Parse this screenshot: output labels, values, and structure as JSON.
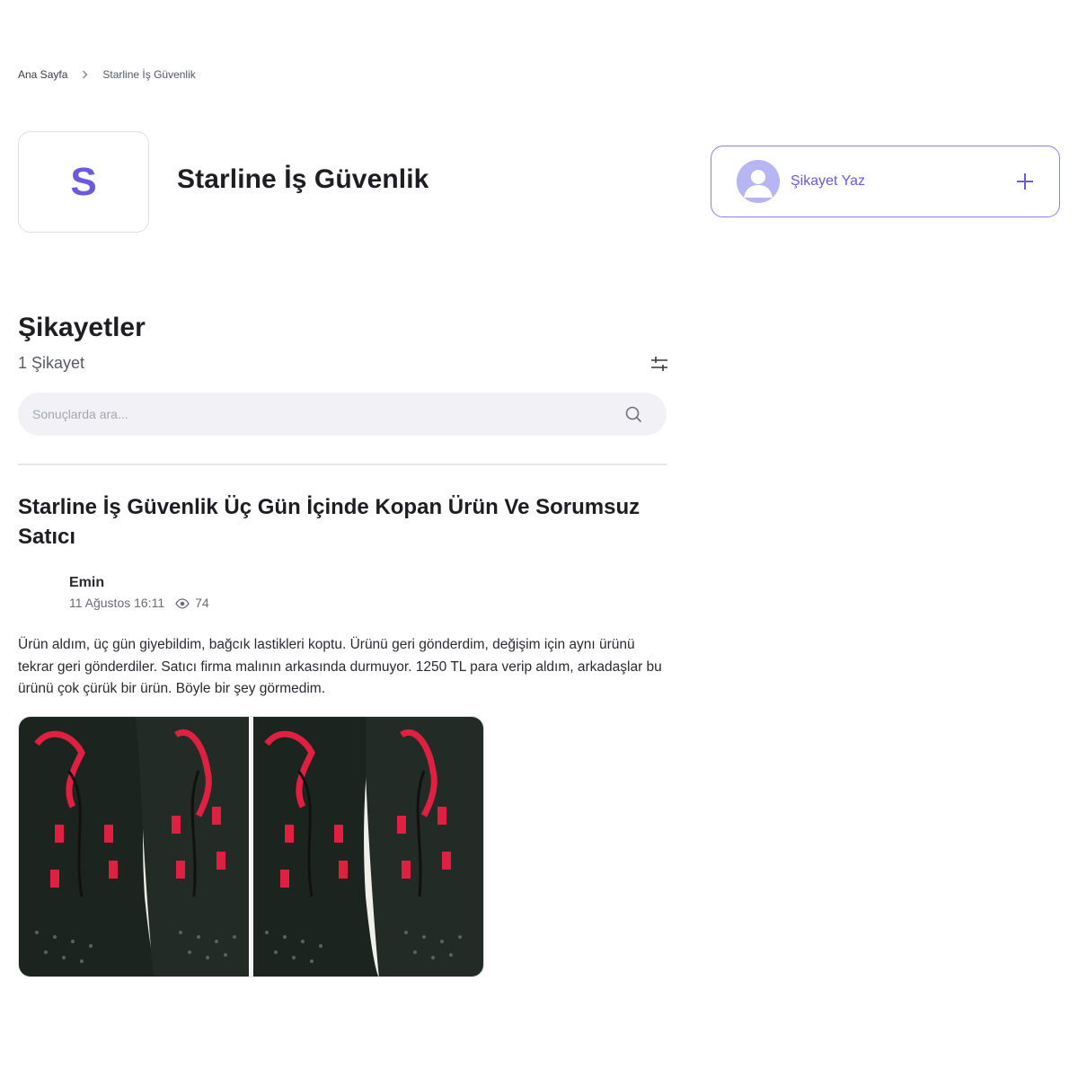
{
  "breadcrumb": {
    "home": "Ana Sayfa",
    "current": "Starline İş Güvenlik"
  },
  "brand": {
    "logo_letter": "S",
    "name": "Starline İş Güvenlik",
    "accent_color": "#6a5ae0"
  },
  "write_card": {
    "label": "Şikayet Yaz",
    "icon": "plus-icon"
  },
  "complaints": {
    "title": "Şikayetler",
    "count_text": "1 Şikayet",
    "search_placeholder": "Sonuçlarda ara...",
    "search_value": ""
  },
  "complaint": {
    "title": "Starline İş Güvenlik Üç Gün İçinde Kopan Ürün Ve Sorumsuz Satıcı",
    "author": "Emin",
    "date": "11 Ağustos 16:11",
    "views": "74",
    "body": "Ürün aldım, üç gün giyebildim, bağcık lastikleri koptu. Ürünü geri gönderdim, değişim için aynı ürünü tekrar geri gönderdiler. Satıcı firma malının arkasında durmuyor. 1250 TL para verip aldım, arkadaşlar bu ürünü çok çürük bir ürün. Böyle bir şey görmedim.",
    "image_description_icon": "shoe-photo"
  }
}
